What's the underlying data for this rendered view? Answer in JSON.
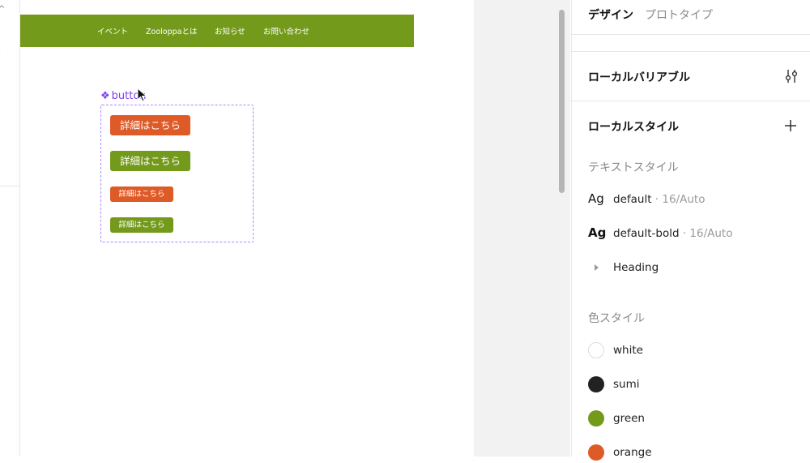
{
  "canvas": {
    "navbar": {
      "items": [
        "イベント",
        "Zooloppaとは",
        "お知らせ",
        "お問い合わせ"
      ],
      "color": "#749a1c"
    },
    "component": {
      "label": "button",
      "buttons": [
        {
          "label": "詳細はこちら",
          "color": "#de5a27"
        },
        {
          "label": "詳細はこちら",
          "color": "#749a1c"
        },
        {
          "label": "詳細はこちら",
          "color": "#de5a27"
        },
        {
          "label": "詳細はこちら",
          "color": "#749a1c"
        }
      ]
    }
  },
  "panel": {
    "tabs": {
      "design": "デザイン",
      "prototype": "プロトタイプ"
    },
    "local_variables": {
      "title": "ローカルバリアブル",
      "icon": "sliders-icon"
    },
    "local_styles": {
      "title": "ローカルスタイル",
      "icon": "plus-icon"
    },
    "text_styles": {
      "heading": "テキストスタイル",
      "items": [
        {
          "preview": "Ag",
          "name": "default",
          "meta": " · 16/Auto"
        },
        {
          "preview": "Ag",
          "name": "default-bold",
          "meta": " · 16/Auto"
        },
        {
          "name": "Heading"
        }
      ]
    },
    "color_styles": {
      "heading": "色スタイル",
      "items": [
        {
          "name": "white",
          "color": "#ffffff"
        },
        {
          "name": "sumi",
          "color": "#222222"
        },
        {
          "name": "green",
          "color": "#749a1c"
        },
        {
          "name": "orange",
          "color": "#de5a27"
        }
      ]
    }
  }
}
